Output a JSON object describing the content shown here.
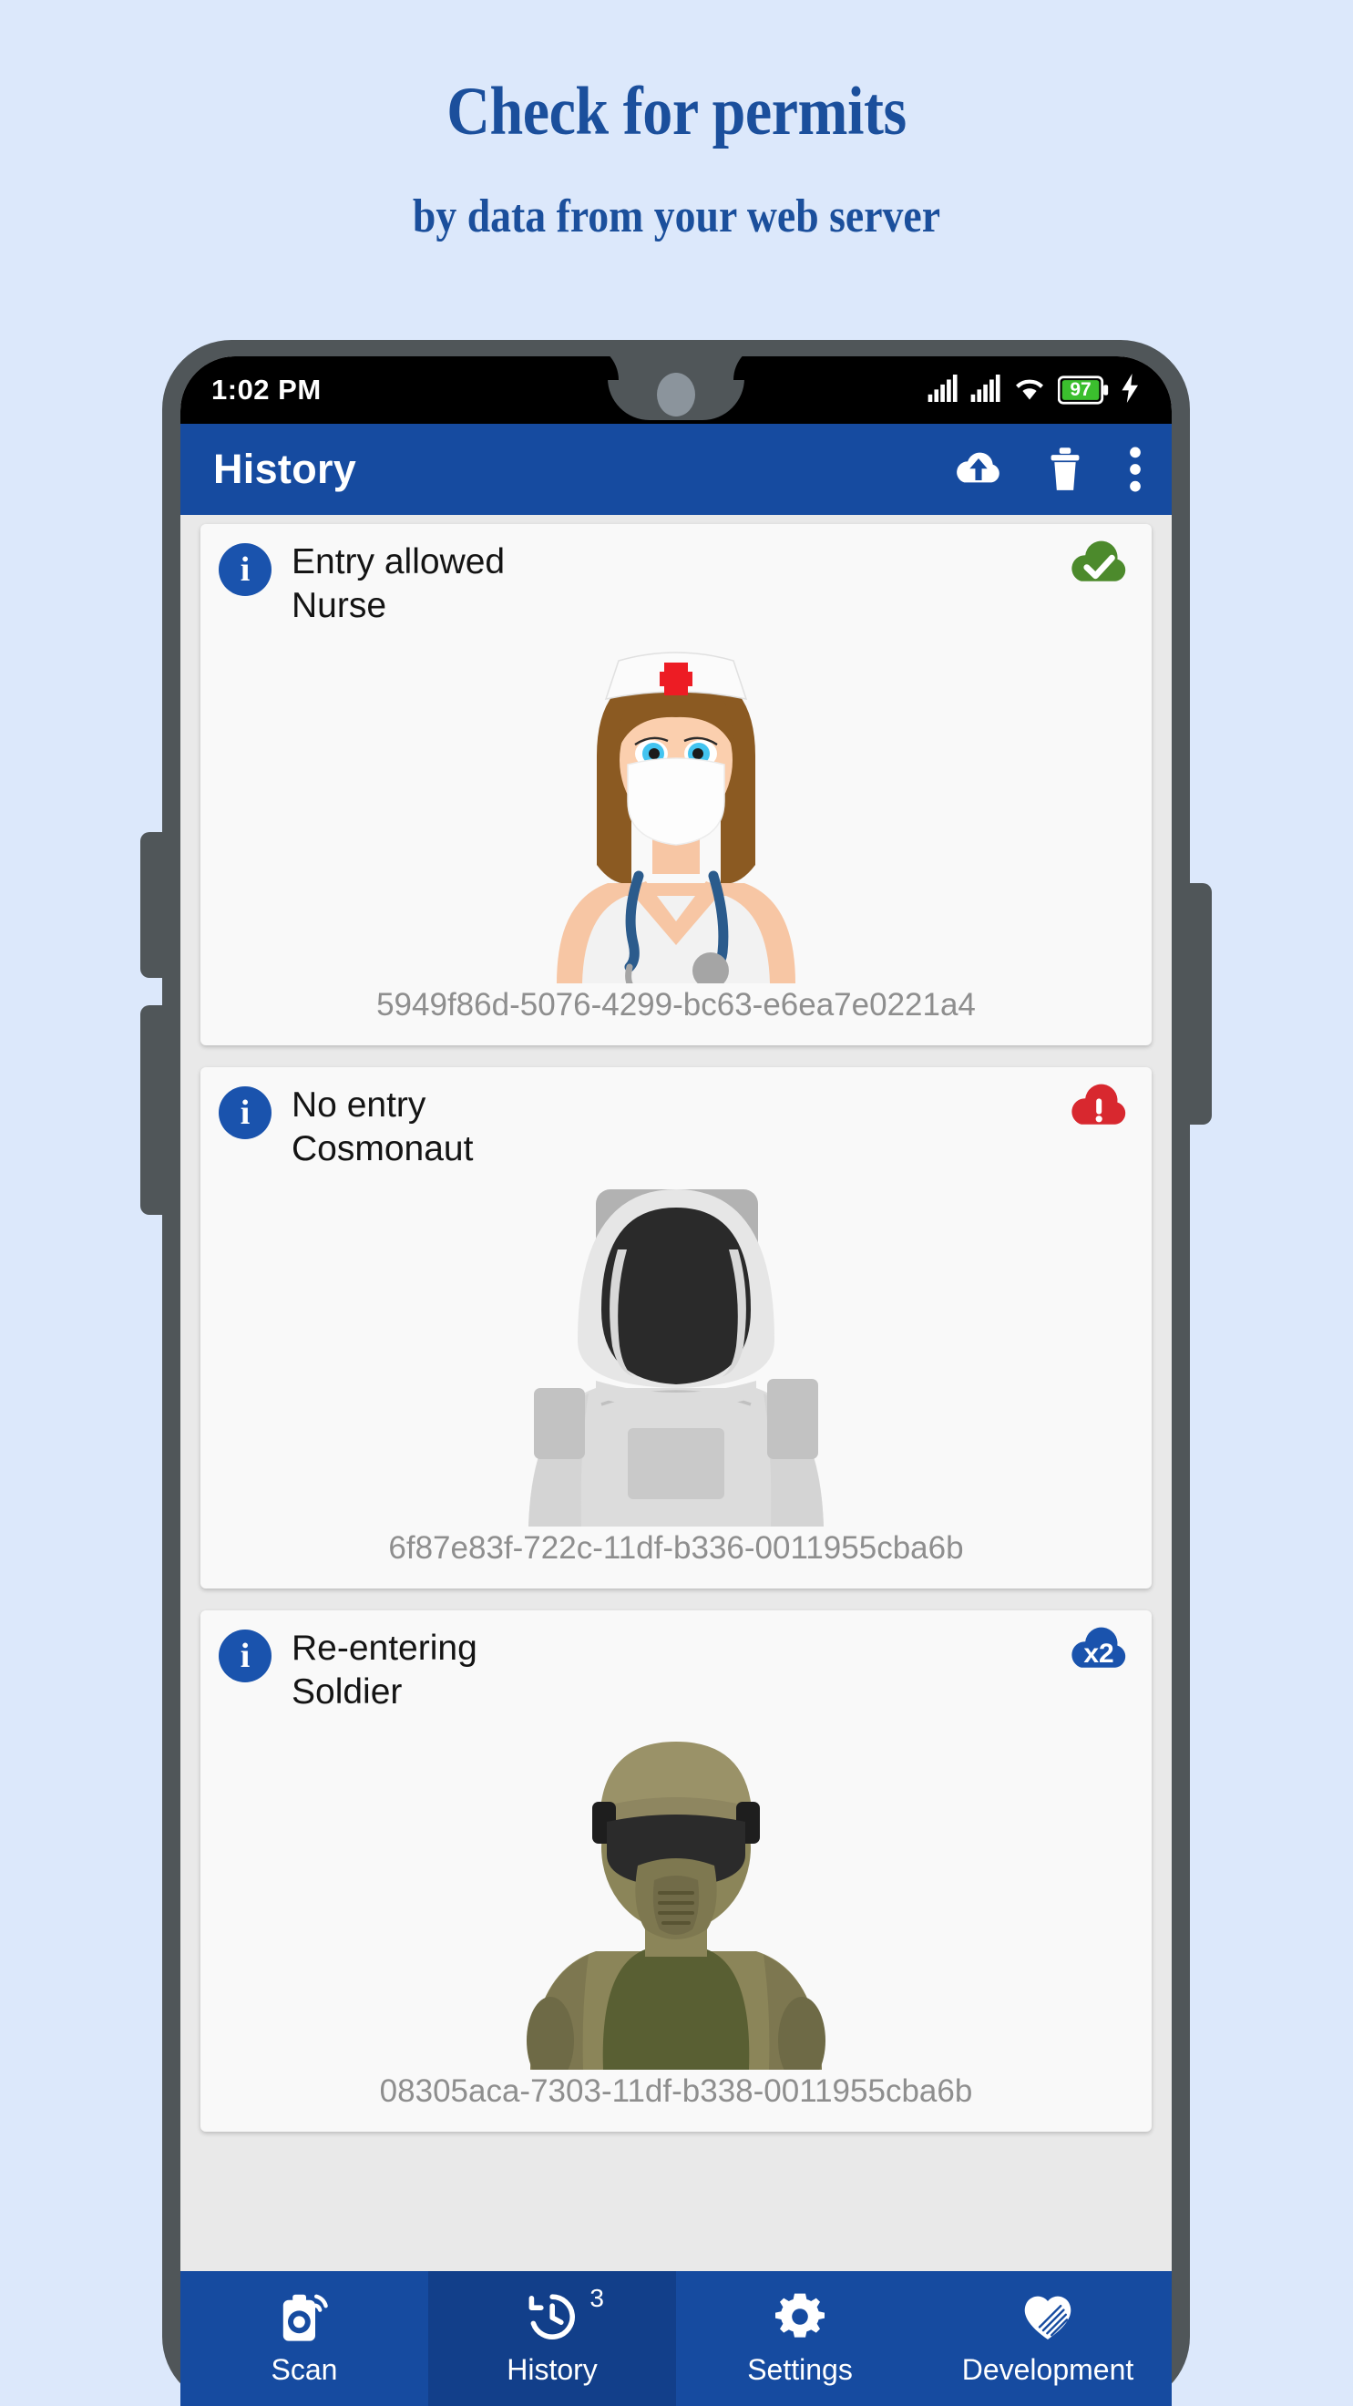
{
  "promo": {
    "title": "Check for permits",
    "subtitle": "by data from your web server",
    "title_color": "#1b4f9c",
    "background_color": "#dce8fb"
  },
  "statusbar": {
    "time": "1:02 PM",
    "signal1_icon": "cellular-signal-icon",
    "signal2_icon": "cellular-signal-icon",
    "wifi_icon": "wifi-icon",
    "battery_level": "97",
    "battery_icon": "battery-icon",
    "charging_icon": "charging-bolt-icon"
  },
  "appbar": {
    "title": "History",
    "accent_color": "#164ba0",
    "actions": [
      {
        "name": "cloud-upload-icon",
        "label": "Upload"
      },
      {
        "name": "delete-icon",
        "label": "Delete"
      },
      {
        "name": "overflow-menu-icon",
        "label": "More options"
      }
    ]
  },
  "history": {
    "entries": [
      {
        "status": "Entry allowed",
        "role": "Nurse",
        "uuid": "5949f86d-5076-4299-bc63-e6ea7e0221a4",
        "badge_type": "cloud-check",
        "badge_color": "#4c8a2c",
        "badge_text": "",
        "info_icon": "info-icon",
        "avatar": "nurse-avatar"
      },
      {
        "status": "No entry",
        "role": "Cosmonaut",
        "uuid": "6f87e83f-722c-11df-b336-0011955cba6b",
        "badge_type": "cloud-alert",
        "badge_color": "#d8282f",
        "badge_text": "",
        "info_icon": "info-icon",
        "avatar": "cosmonaut-avatar"
      },
      {
        "status": "Re-entering",
        "role": "Soldier",
        "uuid": "08305aca-7303-11df-b338-0011955cba6b",
        "badge_type": "cloud-count",
        "badge_color": "#1a53ad",
        "badge_text": "x2",
        "info_icon": "info-icon",
        "avatar": "soldier-avatar"
      }
    ]
  },
  "bottomnav": {
    "items": [
      {
        "label": "Scan",
        "icon": "scan-camera-icon",
        "active": false,
        "badge": ""
      },
      {
        "label": "History",
        "icon": "history-clock-icon",
        "active": true,
        "badge": "3"
      },
      {
        "label": "Settings",
        "icon": "gear-icon",
        "active": false,
        "badge": ""
      },
      {
        "label": "Development",
        "icon": "handshake-heart-icon",
        "active": false,
        "badge": ""
      }
    ]
  }
}
